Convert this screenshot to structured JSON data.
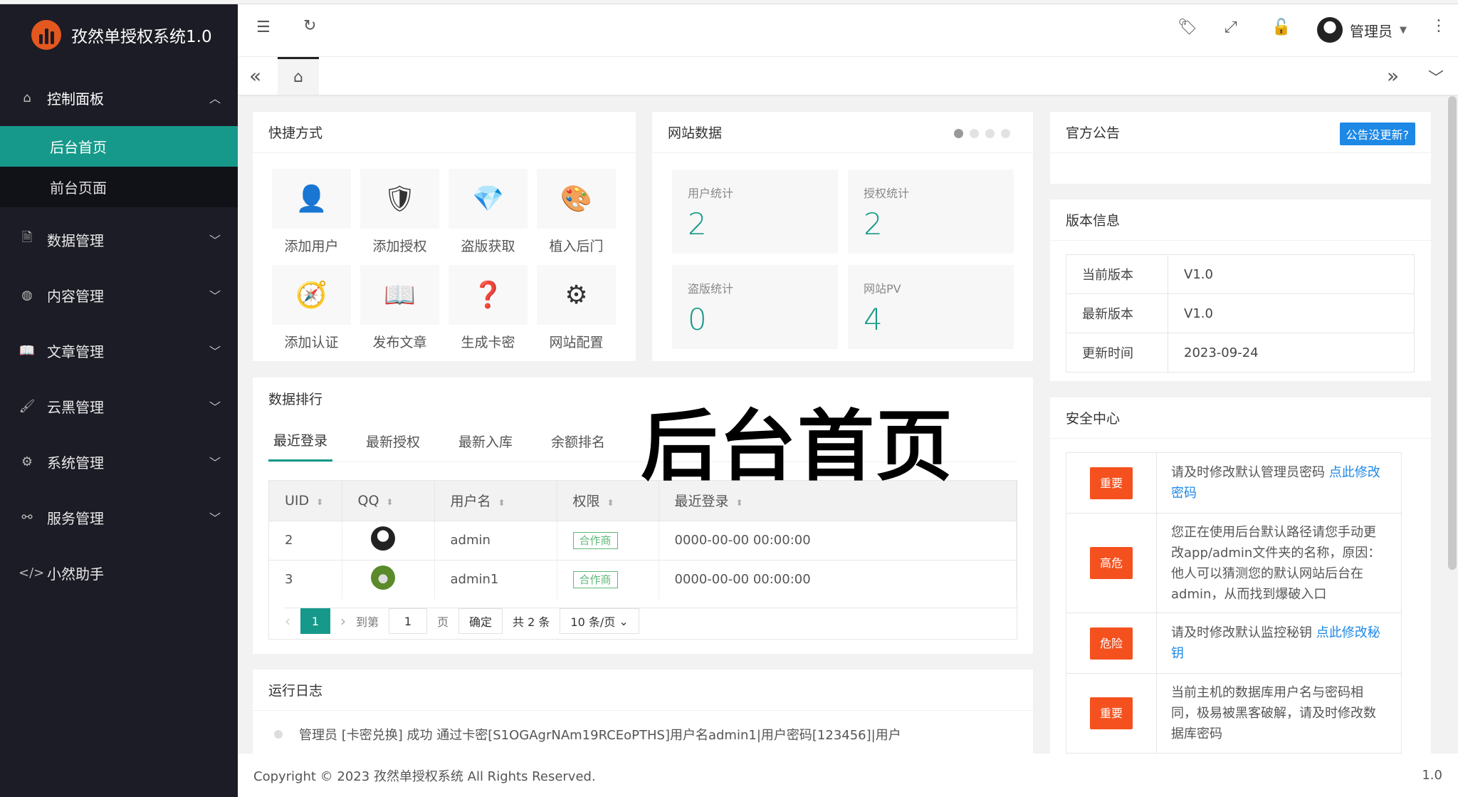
{
  "app": {
    "title": "孜然单授权系统1.0",
    "logo_icon": "logo-bars-icon"
  },
  "sidebar": {
    "dashboard": {
      "label": "控制面板",
      "icon": "home-icon"
    },
    "sub": [
      {
        "label": "后台首页",
        "active": true
      },
      {
        "label": "前台页面",
        "active": false
      }
    ],
    "items": [
      {
        "label": "数据管理",
        "icon": "document-icon"
      },
      {
        "label": "内容管理",
        "icon": "globe-icon"
      },
      {
        "label": "文章管理",
        "icon": "book-icon"
      },
      {
        "label": "云黑管理",
        "icon": "brush-icon"
      },
      {
        "label": "系统管理",
        "icon": "gear-icon"
      },
      {
        "label": "服务管理",
        "icon": "link-break-icon"
      },
      {
        "label": "小然助手",
        "icon": "code-icon"
      }
    ]
  },
  "header": {
    "user": "管理员"
  },
  "overlay": {
    "title": "后台首页"
  },
  "quick": {
    "title": "快捷方式",
    "items": [
      {
        "label": "添加用户",
        "icon": "user-icon"
      },
      {
        "label": "添加授权",
        "icon": "shield-check-icon"
      },
      {
        "label": "盗版获取",
        "icon": "diamond-icon"
      },
      {
        "label": "植入后门",
        "icon": "palette-icon"
      },
      {
        "label": "添加认证",
        "icon": "compass-icon"
      },
      {
        "label": "发布文章",
        "icon": "book-open-icon"
      },
      {
        "label": "生成卡密",
        "icon": "question-edit-icon"
      },
      {
        "label": "网站配置",
        "icon": "gear-icon"
      }
    ]
  },
  "site": {
    "title": "网站数据",
    "stats": [
      {
        "label": "用户统计",
        "value": "2"
      },
      {
        "label": "授权统计",
        "value": "2"
      },
      {
        "label": "盗版统计",
        "value": "0"
      },
      {
        "label": "网站PV",
        "value": "4"
      }
    ]
  },
  "notice": {
    "title": "官方公告",
    "button": "公告没更新?"
  },
  "version": {
    "title": "版本信息",
    "rows": [
      {
        "k": "当前版本",
        "v": "V1.0"
      },
      {
        "k": "最新版本",
        "v": "V1.0"
      },
      {
        "k": "更新时间",
        "v": "2023-09-24"
      }
    ]
  },
  "security": {
    "title": "安全中心",
    "rows": [
      {
        "level": "重要",
        "text": "请及时修改默认管理员密码 ",
        "link": "点此修改密码"
      },
      {
        "level": "高危",
        "text": "您正在使用后台默认路径请您手动更改app/admin文件夹的名称，原因：他人可以猜测您的默认网站后台在admin，从而找到爆破入口",
        "link": ""
      },
      {
        "level": "危险",
        "text": "请及时修改默认监控秘钥 ",
        "link": "点此修改秘钥"
      },
      {
        "level": "重要",
        "text": "当前主机的数据库用户名与密码相同，极易被黑客破解，请及时修改数据库密码",
        "link": ""
      }
    ]
  },
  "ranking": {
    "title": "数据排行",
    "tabs": [
      "最近登录",
      "最新授权",
      "最新入库",
      "余额排名"
    ],
    "columns": [
      "UID",
      "QQ",
      "用户名",
      "权限",
      "最近登录"
    ],
    "rows": [
      {
        "uid": "2",
        "user": "admin",
        "role": "合作商",
        "login": "0000-00-00 00:00:00"
      },
      {
        "uid": "3",
        "user": "admin1",
        "role": "合作商",
        "login": "0000-00-00 00:00:00"
      }
    ],
    "pager": {
      "current": "1",
      "goto_label": "到第",
      "goto_value": "1",
      "page_label": "页",
      "confirm": "确定",
      "total": "共 2 条",
      "per_page": "10 条/页"
    }
  },
  "log": {
    "title": "运行日志",
    "entries": [
      "管理员 [卡密兑换] 成功 通过卡密[S1OGAgrNAm19RCEoPTHS]用户名admin1|用户密码[123456]|用户"
    ]
  },
  "footer": {
    "copyright": "Copyright © 2023 孜然单授权系统 All Rights Reserved.",
    "version": "1.0"
  },
  "colors": {
    "accent": "#16998a",
    "sidebar": "#1c1c26",
    "danger": "#f4511e",
    "link": "#1e88e5"
  }
}
